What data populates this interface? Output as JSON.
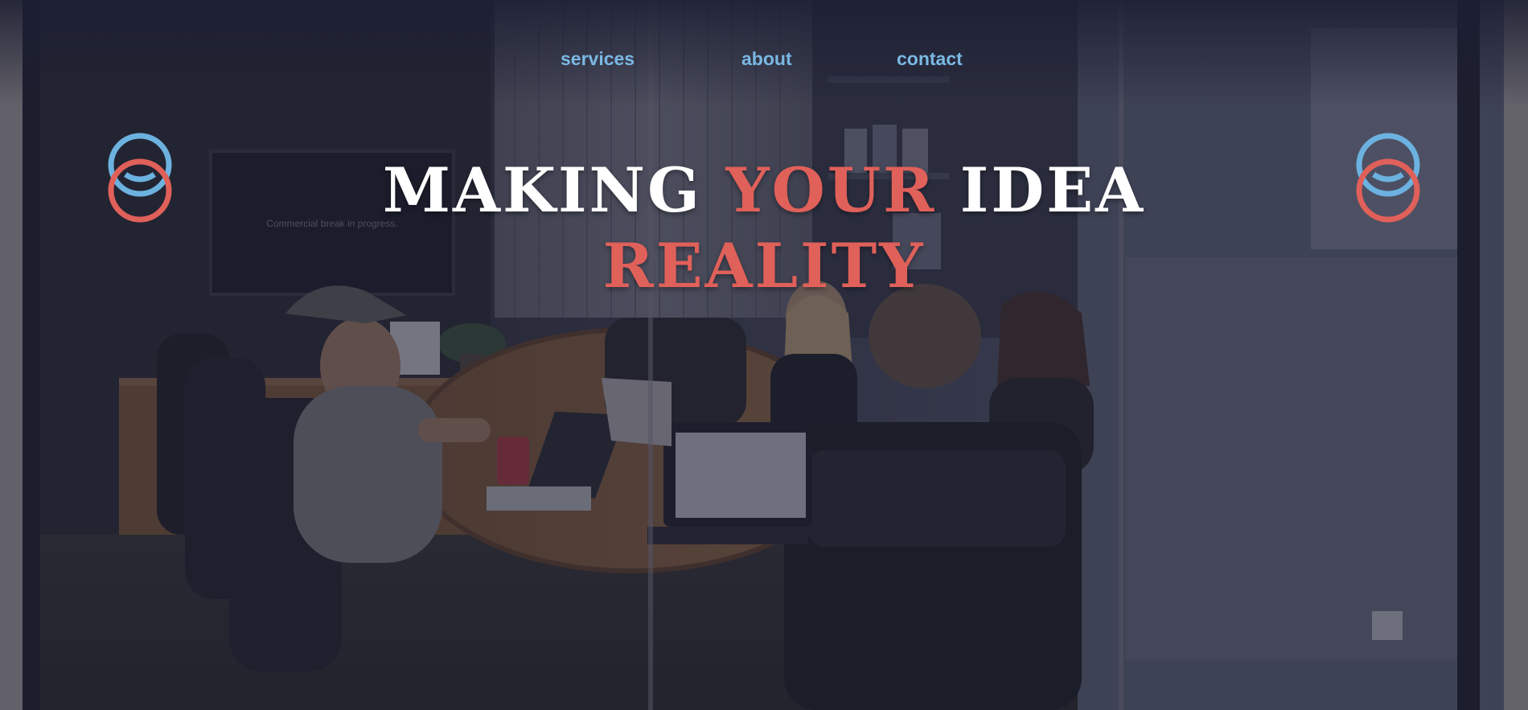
{
  "nav": {
    "items": [
      {
        "label": "services"
      },
      {
        "label": "about"
      },
      {
        "label": "contact"
      }
    ]
  },
  "hero": {
    "headline": {
      "part1": "MAKING",
      "accent1": "YOUR",
      "part2": "IDEA",
      "accent2": "REALITY"
    },
    "background_text": "Commercial break in progress.",
    "background_description": "Photo of a team meeting in a glass-walled conference room with laptops on a round wooden table"
  },
  "logo": {
    "icon": "two-interlocking-rings-logo-icon",
    "colors": [
      "#6cb2e0",
      "#e0605a"
    ]
  },
  "colors": {
    "nav_link": "#7ab8e3",
    "headline": "#ffffff",
    "accent": "#e0605a",
    "overlay": "#1c1f33"
  }
}
